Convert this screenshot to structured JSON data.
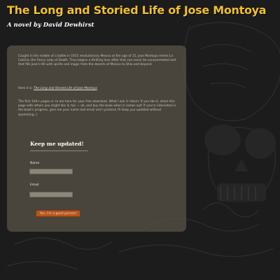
{
  "header": {
    "title": "The Long and Storied Life of Jose Montoya",
    "byline": "A novel by David Dewhirst"
  },
  "intro": {
    "paragraph1": "Caught in the middle of a battle in 1915 revolutionary Mexico at the age of 15, Jose Montoya meets La Catrina, the Fancy Lady of Death. Thus begins a thrilling love affair that can never be consummated and that fills Jose's life with spirits and magic from the deserts of Mexico to Ohio and beyond.",
    "paragraph2_prefix": "Here it is: ",
    "paragraph2_link": "The Long and Storied Life of Jose Montoya",
    "paragraph3": "The first 100+ pages or so are here for your free download. What I ask in return: If you like it, share this page with others you might like it, too — oh, and buy the book when it comes out! If you're interested in the book's progress, give me your name and email and I promise I'll keep you updated without spamming :)"
  },
  "signup": {
    "title": "Keep me updated!",
    "name_label": "Name",
    "name_value": "",
    "email_label": "Email",
    "email_value": "",
    "submit_label": "Yes, I'm a good person!"
  },
  "colors": {
    "title": "#f0c02a",
    "panel": "#565145",
    "button": "#b8561c"
  }
}
